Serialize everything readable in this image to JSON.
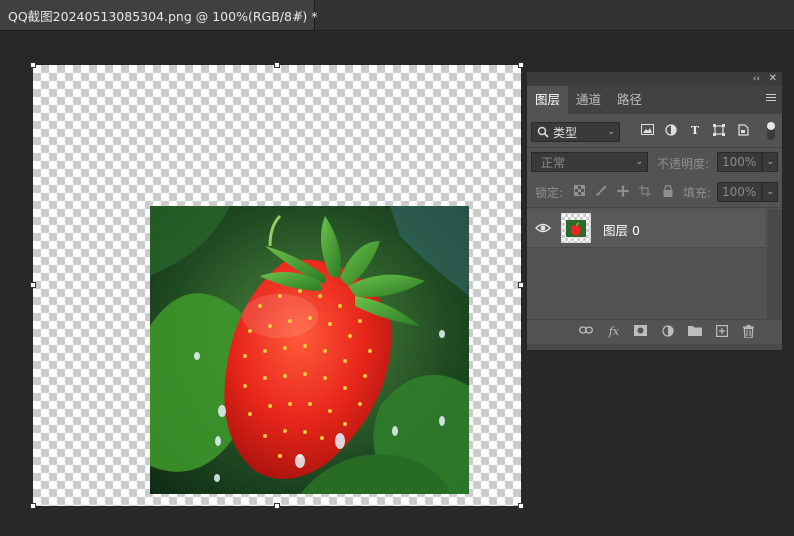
{
  "document": {
    "tab_title": "QQ截图20240513085304.png @ 100%(RGB/8#) *",
    "close_glyph": "×"
  },
  "canvas": {
    "transparency": "checkerboard",
    "image": "strawberry with water droplets on green leaves"
  },
  "panel": {
    "collapse_glyph": "‹‹",
    "close_glyph": "✕",
    "tabs": [
      "图层",
      "通道",
      "路径"
    ],
    "active_tab": "图层",
    "filter": {
      "search_icon": "magnifier-icon",
      "kind": "类型"
    },
    "filter_icons": [
      "image-filter-icon",
      "adjustment-filter-icon",
      "type-filter-icon",
      "shape-filter-icon",
      "smart-object-filter-icon"
    ],
    "blend_mode": "正常",
    "opacity_label": "不透明度:",
    "opacity_value": "100%",
    "lock_label": "锁定:",
    "fill_label": "填充:",
    "fill_value": "100%",
    "layers": [
      {
        "name": "图层 0",
        "visible": true
      }
    ],
    "bottom_icons": [
      "link-layers-icon",
      "fx-icon",
      "add-mask-icon",
      "adjustment-layer-icon",
      "group-folder-icon",
      "new-layer-icon",
      "trash-icon"
    ],
    "fx_label": "fx"
  },
  "colors": {
    "app_bg": "#282828",
    "panel_bg": "#535353",
    "tab_bg": "#404040",
    "strawberry": "#e8261b",
    "leaf": "#3f9a2b"
  }
}
